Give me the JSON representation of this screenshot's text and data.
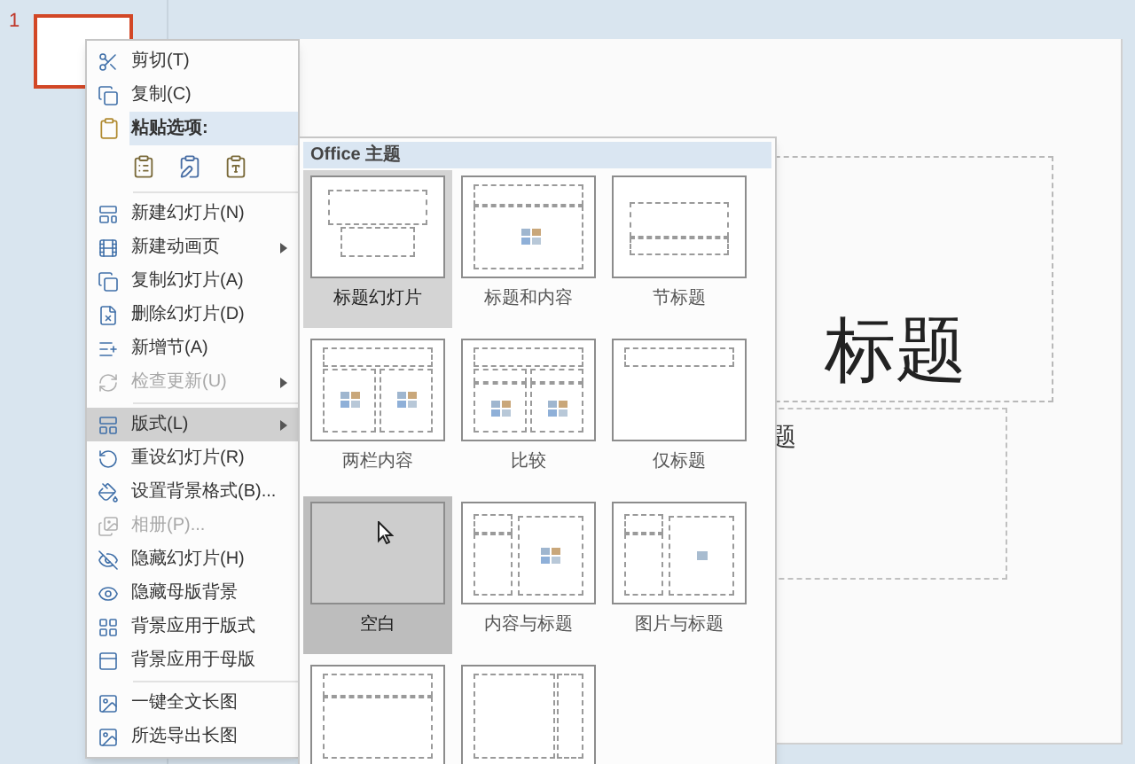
{
  "thumbnail_panel": {
    "slide_number": "1"
  },
  "slide": {
    "title": "标题",
    "subtitle": "题"
  },
  "context_menu": {
    "items": [
      {
        "kind": "item",
        "label": "剪切(T)",
        "disabled": false,
        "highlighted": false,
        "submenu": false
      },
      {
        "kind": "item",
        "label": "复制(C)",
        "disabled": false,
        "highlighted": false,
        "submenu": false
      },
      {
        "kind": "header",
        "label": "粘贴选项:"
      },
      {
        "kind": "paste_options"
      },
      {
        "kind": "separator"
      },
      {
        "kind": "item",
        "label": "新建幻灯片(N)",
        "disabled": false,
        "highlighted": false,
        "submenu": false
      },
      {
        "kind": "item",
        "label": "新建动画页",
        "disabled": false,
        "highlighted": false,
        "submenu": true
      },
      {
        "kind": "item",
        "label": "复制幻灯片(A)",
        "disabled": false,
        "highlighted": false,
        "submenu": false
      },
      {
        "kind": "item",
        "label": "删除幻灯片(D)",
        "disabled": false,
        "highlighted": false,
        "submenu": false
      },
      {
        "kind": "item",
        "label": "新增节(A)",
        "disabled": false,
        "highlighted": false,
        "submenu": false
      },
      {
        "kind": "item",
        "label": "检查更新(U)",
        "disabled": true,
        "highlighted": false,
        "submenu": true
      },
      {
        "kind": "separator"
      },
      {
        "kind": "item",
        "label": "版式(L)",
        "disabled": false,
        "highlighted": true,
        "submenu": true
      },
      {
        "kind": "item",
        "label": "重设幻灯片(R)",
        "disabled": false,
        "highlighted": false,
        "submenu": false
      },
      {
        "kind": "item",
        "label": "设置背景格式(B)...",
        "disabled": false,
        "highlighted": false,
        "submenu": false
      },
      {
        "kind": "item",
        "label": "相册(P)...",
        "disabled": true,
        "highlighted": false,
        "submenu": false
      },
      {
        "kind": "item",
        "label": "隐藏幻灯片(H)",
        "disabled": false,
        "highlighted": false,
        "submenu": false
      },
      {
        "kind": "item",
        "label": "隐藏母版背景",
        "disabled": false,
        "highlighted": false,
        "submenu": false
      },
      {
        "kind": "item",
        "label": "背景应用于版式",
        "disabled": false,
        "highlighted": false,
        "submenu": false
      },
      {
        "kind": "item",
        "label": "背景应用于母版",
        "disabled": false,
        "highlighted": false,
        "submenu": false
      },
      {
        "kind": "separator"
      },
      {
        "kind": "item",
        "label": "一键全文长图",
        "disabled": false,
        "highlighted": false,
        "submenu": false
      },
      {
        "kind": "item",
        "label": "所选导出长图",
        "disabled": false,
        "highlighted": false,
        "submenu": false
      }
    ]
  },
  "layout_menu": {
    "header": "Office 主题",
    "layouts": [
      {
        "kind": "title",
        "label": "标题幻灯片",
        "selected": true,
        "hovered": false
      },
      {
        "kind": "title-content",
        "label": "标题和内容",
        "selected": false,
        "hovered": false
      },
      {
        "kind": "section",
        "label": "节标题",
        "selected": false,
        "hovered": false
      },
      {
        "kind": "two-content",
        "label": "两栏内容",
        "selected": false,
        "hovered": false
      },
      {
        "kind": "comparison",
        "label": "比较",
        "selected": false,
        "hovered": false
      },
      {
        "kind": "title-only",
        "label": "仅标题",
        "selected": false,
        "hovered": false
      },
      {
        "kind": "blank",
        "label": "空白",
        "selected": false,
        "hovered": true
      },
      {
        "kind": "content-caption",
        "label": "内容与标题",
        "selected": false,
        "hovered": false
      },
      {
        "kind": "picture-caption",
        "label": "图片与标题",
        "selected": false,
        "hovered": false
      },
      {
        "kind": "vertical-text",
        "selected": false,
        "hovered": false
      },
      {
        "kind": "vertical-title",
        "selected": false,
        "hovered": false
      }
    ]
  }
}
